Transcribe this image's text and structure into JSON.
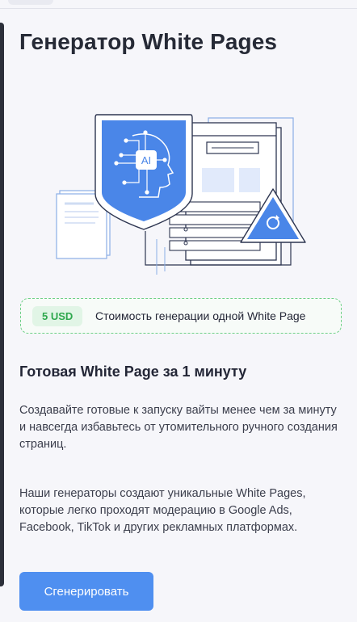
{
  "page": {
    "title": "Генератор White Pages"
  },
  "hero": {
    "icon": "ai-shield-browser-illustration",
    "ai_label": "AI"
  },
  "pricing": {
    "badge": "5 USD",
    "description": "Стоимость генерации одной White Page"
  },
  "content": {
    "subtitle": "Готовая White Page за 1 минуту",
    "paragraph1": "Создавайте готовые к запуску вайты менее чем за минуту и навсегда избавьтесь от утомительного ручного создания страниц.",
    "paragraph2": "Наши генераторы создают уникальные White Pages, которые легко проходят модерацию в Google Ads, Facebook, TikTok и других рекламных платформах."
  },
  "actions": {
    "generate_label": "Сгенерировать"
  },
  "colors": {
    "accent": "#4f8ff0",
    "price_green": "#2ea84d",
    "shield_blue": "#4a86e8"
  }
}
